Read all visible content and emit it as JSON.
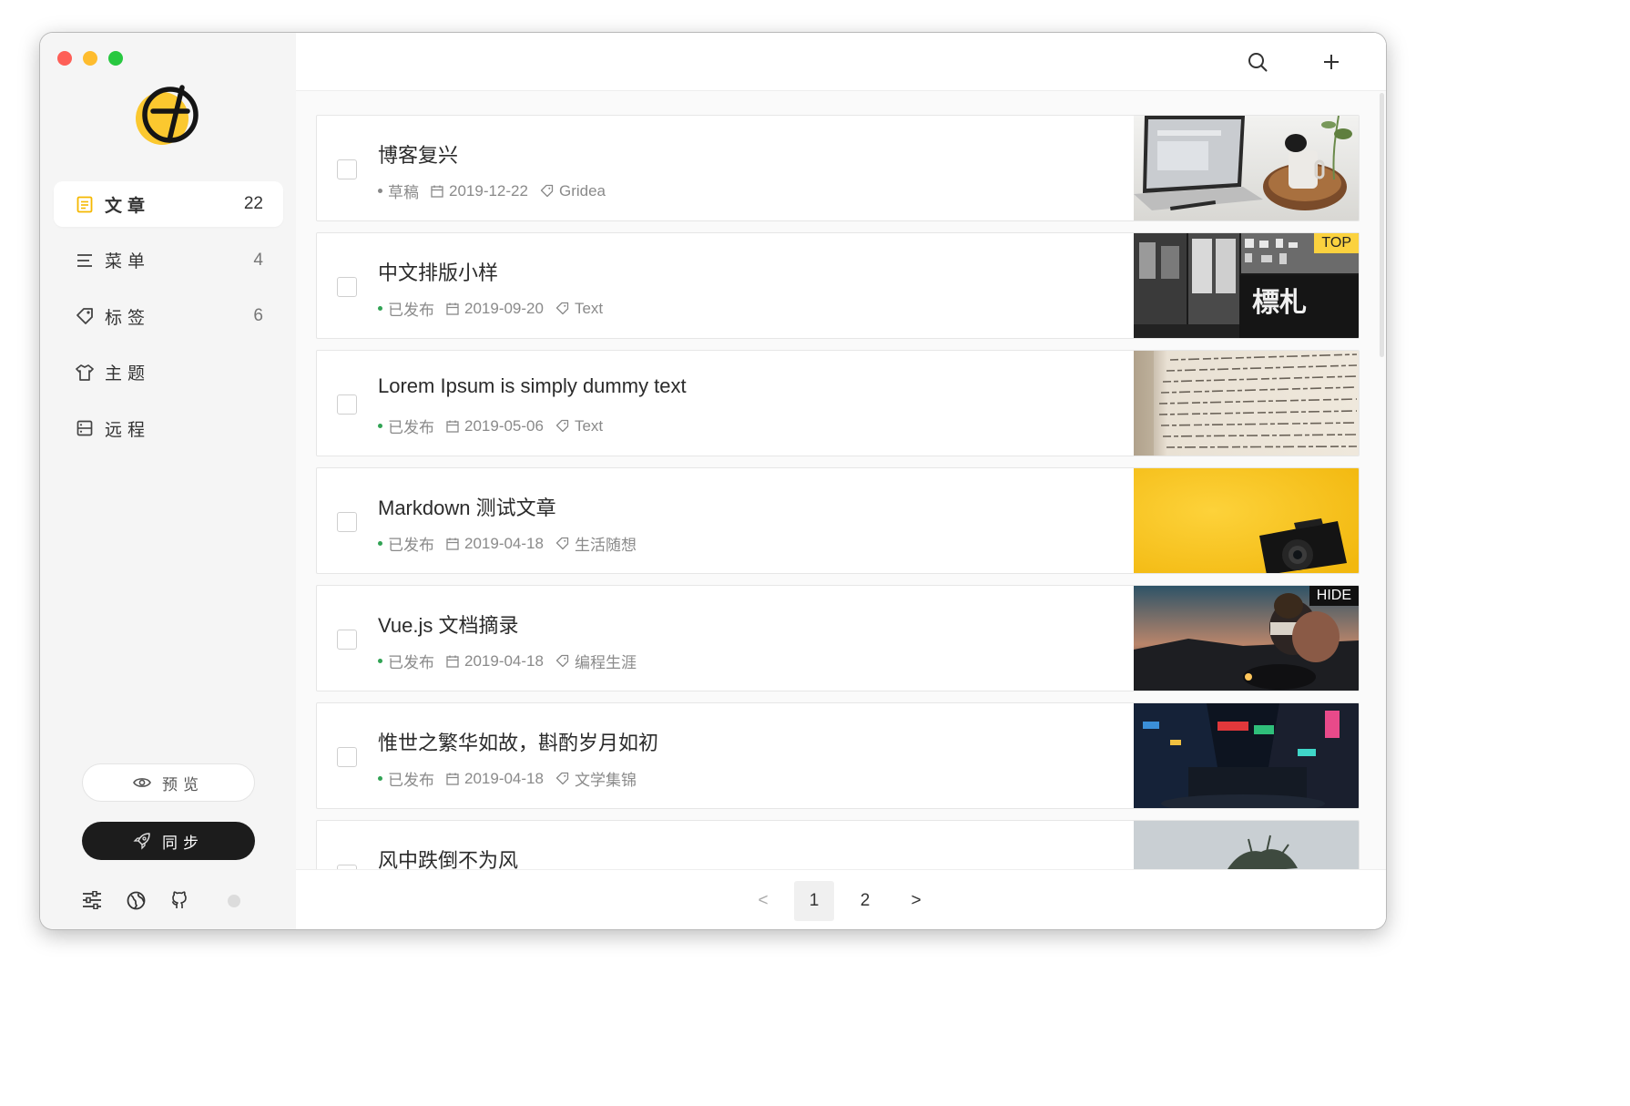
{
  "sidebar": {
    "nav": [
      {
        "label": "文章",
        "count": "22",
        "icon": "article-icon"
      },
      {
        "label": "菜单",
        "count": "4",
        "icon": "menu-icon"
      },
      {
        "label": "标签",
        "count": "6",
        "icon": "tag-icon"
      },
      {
        "label": "主题",
        "count": "",
        "icon": "theme-icon"
      },
      {
        "label": "远程",
        "count": "",
        "icon": "remote-icon"
      }
    ],
    "preview_label": "预览",
    "sync_label": "同步"
  },
  "posts": [
    {
      "title": "博客复兴",
      "status": "草稿",
      "date": "2019-12-22",
      "tag": "Gridea",
      "badge": ""
    },
    {
      "title": "中文排版小样",
      "status": "已发布",
      "date": "2019-09-20",
      "tag": "Text",
      "badge": "TOP"
    },
    {
      "title": "Lorem Ipsum is simply dummy text",
      "status": "已发布",
      "date": "2019-05-06",
      "tag": "Text",
      "badge": ""
    },
    {
      "title": "Markdown 测试文章",
      "status": "已发布",
      "date": "2019-04-18",
      "tag": "生活随想",
      "badge": ""
    },
    {
      "title": "Vue.js 文档摘录",
      "status": "已发布",
      "date": "2019-04-18",
      "tag": "编程生涯",
      "badge": "HIDE"
    },
    {
      "title": "惟世之繁华如故，斟酌岁月如初",
      "status": "已发布",
      "date": "2019-04-18",
      "tag": "文学集锦",
      "badge": ""
    },
    {
      "title": "风中跌倒不为风",
      "status": "",
      "date": "",
      "tag": "",
      "badge": ""
    }
  ],
  "pagination": {
    "prev": "<",
    "pages": [
      "1",
      "2"
    ],
    "current": "1",
    "next": ">"
  },
  "colors": {
    "accent": "#fbc82f",
    "published": "#31a354",
    "draft": "#8a8a8a",
    "top_badge": "#fbd23f",
    "hide_badge": "#111111"
  }
}
